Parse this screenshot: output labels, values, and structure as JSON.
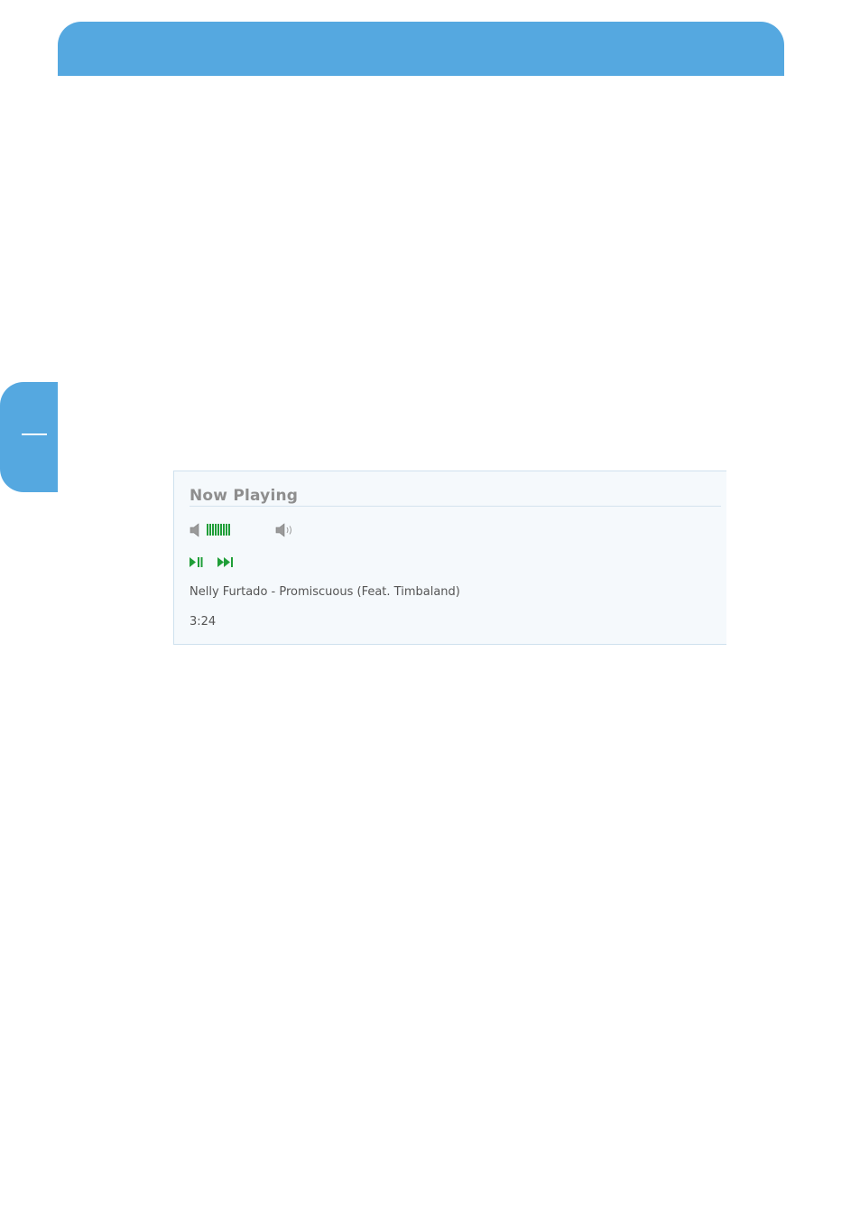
{
  "colors": {
    "accent": "#55a8e0",
    "panel_background": "#f5f9fc",
    "panel_border": "#cfe1ee",
    "title_text": "#8e8e8e",
    "body_text": "#555555",
    "control_green": "#1f9e38"
  },
  "now_playing": {
    "title": "Now Playing",
    "volume": {
      "min_icon": "speaker-low-icon",
      "max_icon": "speaker-high-icon",
      "level_bars": 9
    },
    "controls": {
      "play_pause_icon": "play-pause-icon",
      "next_icon": "skip-next-icon"
    },
    "track": "Nelly Furtado - Promiscuous (Feat. Timbaland)",
    "time": "3:24"
  }
}
